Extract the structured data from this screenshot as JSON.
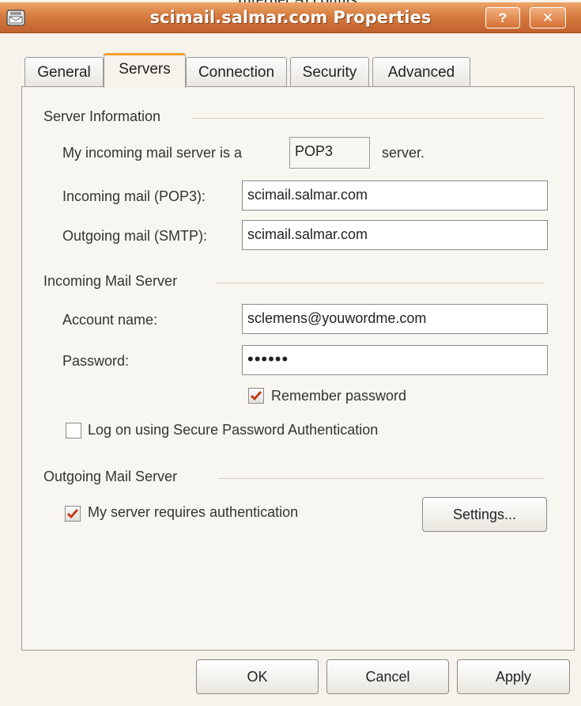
{
  "window": {
    "behind_title": "Internet Accounts",
    "title": "scimail.salmar.com Properties",
    "help_glyph": "?",
    "close_glyph": "✕"
  },
  "tabs": [
    {
      "label": "General"
    },
    {
      "label": "Servers",
      "active": true
    },
    {
      "label": "Connection"
    },
    {
      "label": "Security"
    },
    {
      "label": "Advanced"
    }
  ],
  "server_info": {
    "group_label": "Server Information",
    "incoming_type_prefix": "My incoming mail server is a",
    "incoming_type": "POP3",
    "incoming_type_suffix": "server.",
    "incoming_label": "Incoming mail (POP3):",
    "incoming_value": "scimail.salmar.com",
    "outgoing_label": "Outgoing mail (SMTP):",
    "outgoing_value": "scimail.salmar.com"
  },
  "incoming_server": {
    "group_label": "Incoming Mail Server",
    "account_label": "Account name:",
    "account_value": "sclemens@youwordme.com",
    "password_label": "Password:",
    "password_value": "••••••",
    "remember_label": "Remember password",
    "remember_checked": true,
    "spa_label": "Log on using Secure Password Authentication",
    "spa_checked": false
  },
  "outgoing_server": {
    "group_label": "Outgoing Mail Server",
    "auth_label": "My server requires authentication",
    "auth_checked": true,
    "settings_label": "Settings..."
  },
  "footer": {
    "ok_label": "OK",
    "cancel_label": "Cancel",
    "apply_label": "Apply"
  },
  "colors": {
    "titlebar": "#d67c40",
    "active_tab_accent": "#f0a030",
    "checkmark": "#c43b1a"
  }
}
